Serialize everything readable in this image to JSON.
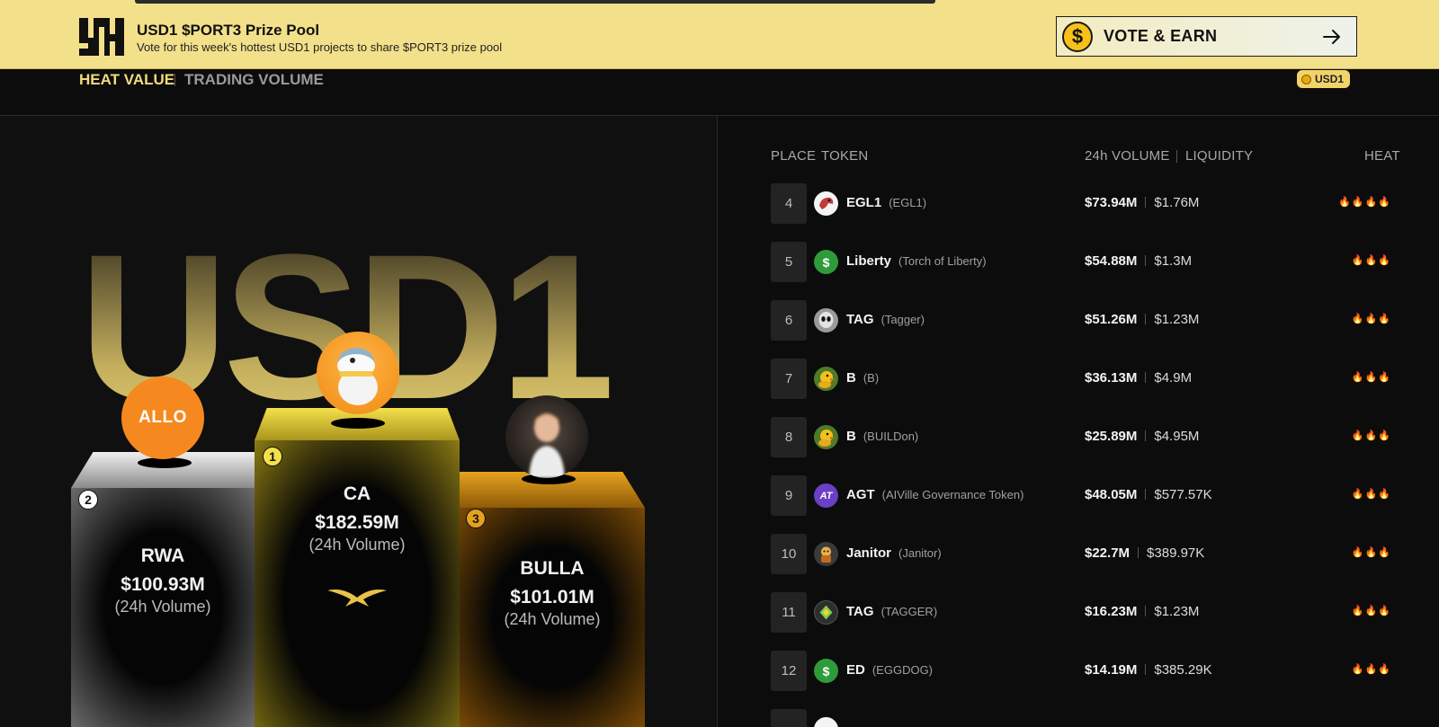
{
  "banner": {
    "title": "USD1 $PORT3 Prize Pool",
    "subtitle": "Vote for this week's hottest USD1 projects to share $PORT3 prize pool",
    "coin_symbol": "$",
    "button_label": "VOTE & EARN",
    "bg_color": "#f3e08a"
  },
  "tabs": {
    "active": "HEAT VALUE",
    "inactive": "TRADING VOLUME",
    "badge": "USD1"
  },
  "podium": {
    "big_word": "USD1",
    "volume_label": "(24h Volume)",
    "first": {
      "rank": "1",
      "name": "CA",
      "volume": "$182.59M"
    },
    "second": {
      "rank": "2",
      "name": "RWA",
      "volume": "$100.93M",
      "avatar_text": "ALLO"
    },
    "third": {
      "rank": "3",
      "name": "BULLA",
      "volume": "$101.01M"
    }
  },
  "table": {
    "headers": {
      "place": "PLACE",
      "token": "TOKEN",
      "volume": "24h VOLUME",
      "liquidity": "LIQUIDITY",
      "heat": "HEAT"
    },
    "rows": [
      {
        "place": "4",
        "symbol": "EGL1",
        "name": "(EGL1)",
        "volume": "$73.94M",
        "liquidity": "$1.76M",
        "heat": "🔥🔥🔥🔥",
        "icon": "eagle-icon"
      },
      {
        "place": "5",
        "symbol": "Liberty",
        "name": "(Torch of Liberty)",
        "volume": "$54.88M",
        "liquidity": "$1.3M",
        "heat": "🔥🔥🔥",
        "icon": "dollar-icon",
        "icon_glyph": "$"
      },
      {
        "place": "6",
        "symbol": "TAG",
        "name": "(Tagger)",
        "volume": "$51.26M",
        "liquidity": "$1.23M",
        "heat": "🔥🔥🔥",
        "icon": "alien-icon"
      },
      {
        "place": "7",
        "symbol": "B",
        "name": "(B)",
        "volume": "$36.13M",
        "liquidity": "$4.9M",
        "heat": "🔥🔥🔥",
        "icon": "duck-icon"
      },
      {
        "place": "8",
        "symbol": "B",
        "name": "(BUILDon)",
        "volume": "$25.89M",
        "liquidity": "$4.95M",
        "heat": "🔥🔥🔥",
        "icon": "duck-icon"
      },
      {
        "place": "9",
        "symbol": "AGT",
        "name": "(AIVille Governance Token)",
        "volume": "$48.05M",
        "liquidity": "$577.57K",
        "heat": "🔥🔥🔥",
        "icon": "agt-icon",
        "icon_glyph": "AT"
      },
      {
        "place": "10",
        "symbol": "Janitor",
        "name": "(Janitor)",
        "volume": "$22.7M",
        "liquidity": "$389.97K",
        "heat": "🔥🔥🔥",
        "icon": "janitor-icon"
      },
      {
        "place": "11",
        "symbol": "TAG",
        "name": "(TAGGER)",
        "volume": "$16.23M",
        "liquidity": "$1.23M",
        "heat": "🔥🔥🔥",
        "icon": "diamond-icon"
      },
      {
        "place": "12",
        "symbol": "ED",
        "name": "(EGGDOG)",
        "volume": "$14.19M",
        "liquidity": "$385.29K",
        "heat": "🔥🔥🔥",
        "icon": "dollar-icon",
        "icon_glyph": "$"
      }
    ]
  }
}
